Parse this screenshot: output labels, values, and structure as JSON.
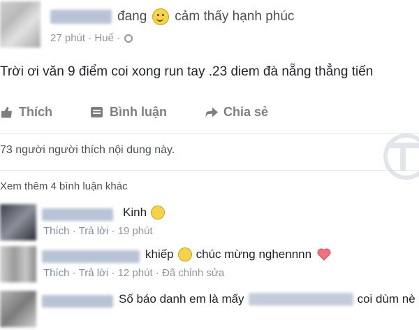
{
  "post": {
    "status_verb": "đang",
    "feeling": "cảm thấy hạnh phúc",
    "time": "27 phút",
    "location": "Huế",
    "body": "Trời ơi văn 9 điểm coi xong run tay .23 diem đà nẵng thẳng tiến"
  },
  "actions": {
    "like": "Thích",
    "comment": "Bình luận",
    "share": "Chia sẻ"
  },
  "likes": "73 người người thích nội dung này.",
  "view_more": "Xem thêm 4 bình luận khác",
  "comments": [
    {
      "text": "Kinh",
      "like": "Thích",
      "reply": "Trả lời",
      "time": "19 phút"
    },
    {
      "text_a": "khiếp",
      "text_b": "chúc mừng nghennnn",
      "like": "Thích",
      "reply": "Trả lời",
      "time": "12 phút",
      "edited": "Đã chỉnh sửa"
    },
    {
      "text_a": "Số báo danh em là mấy",
      "text_b": "coi dùm nè"
    }
  ],
  "colors": {
    "link": "#7f8ba3",
    "muted": "#90949c",
    "action": "#7f7f7f",
    "text": "#1d2129",
    "heart": "#f2737f"
  }
}
